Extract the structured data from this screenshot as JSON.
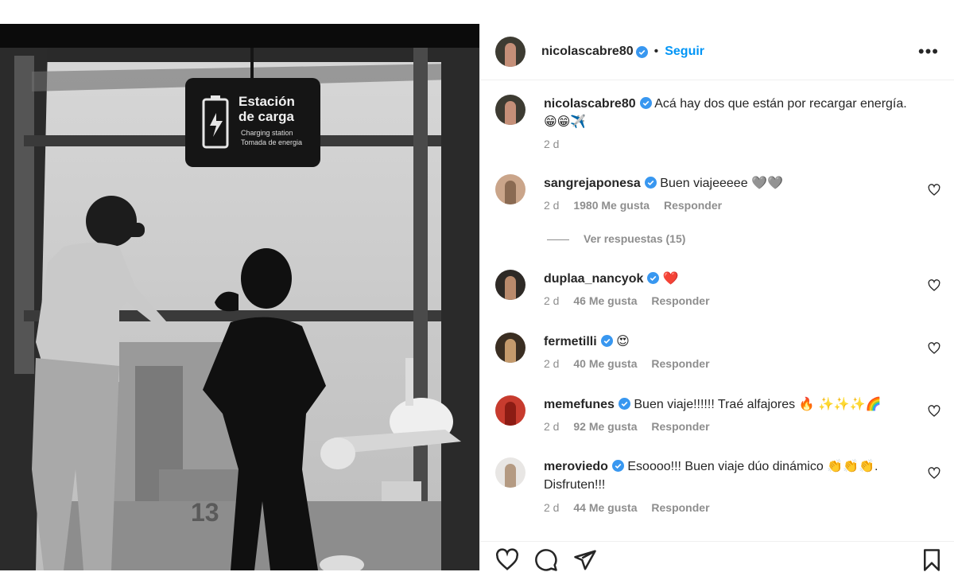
{
  "post": {
    "author": "nicolascabre80",
    "follow_label": "Seguir",
    "more_label": "•••",
    "dot": "•",
    "caption": {
      "username": "nicolascabre80",
      "text": "Acá hay dos que están por recargar energía.",
      "emojis": "😁😁✈️",
      "time": "2 d"
    },
    "sign": {
      "title_line1": "Estación",
      "title_line2": "de carga",
      "sub_line1": "Charging station",
      "sub_line2": "Tomada de energia"
    },
    "gate_number": "13"
  },
  "comments": [
    {
      "username": "sangrejaponesa",
      "text": "Buen viajeeeee 🩶🩶",
      "time": "2 d",
      "likes": "1980 Me gusta",
      "reply": "Responder"
    },
    {
      "username": "duplaa_nancyok",
      "text": "❤️",
      "time": "2 d",
      "likes": "46 Me gusta",
      "reply": "Responder"
    },
    {
      "username": "fermetilli",
      "text": "😍",
      "time": "2 d",
      "likes": "40 Me gusta",
      "reply": "Responder"
    },
    {
      "username": "memefunes",
      "text": "Buen viaje!!!!!! Traé alfajores 🔥 ✨✨✨🌈",
      "time": "2 d",
      "likes": "92 Me gusta",
      "reply": "Responder"
    },
    {
      "username": "meroviedo",
      "text": "Esoooo!!! Buen viaje dúo dinámico 👏👏👏. Disfruten!!!",
      "time": "2 d",
      "likes": "44 Me gusta",
      "reply": "Responder"
    }
  ],
  "view_replies": "Ver respuestas (15)",
  "colors": {
    "accent": "#0095f6",
    "text": "#262626",
    "muted": "#8e8e8e",
    "verified": "#3897f0"
  },
  "icons": [
    "more-icon",
    "verified-icon",
    "heart-icon",
    "comment-icon",
    "share-icon",
    "bookmark-icon"
  ]
}
